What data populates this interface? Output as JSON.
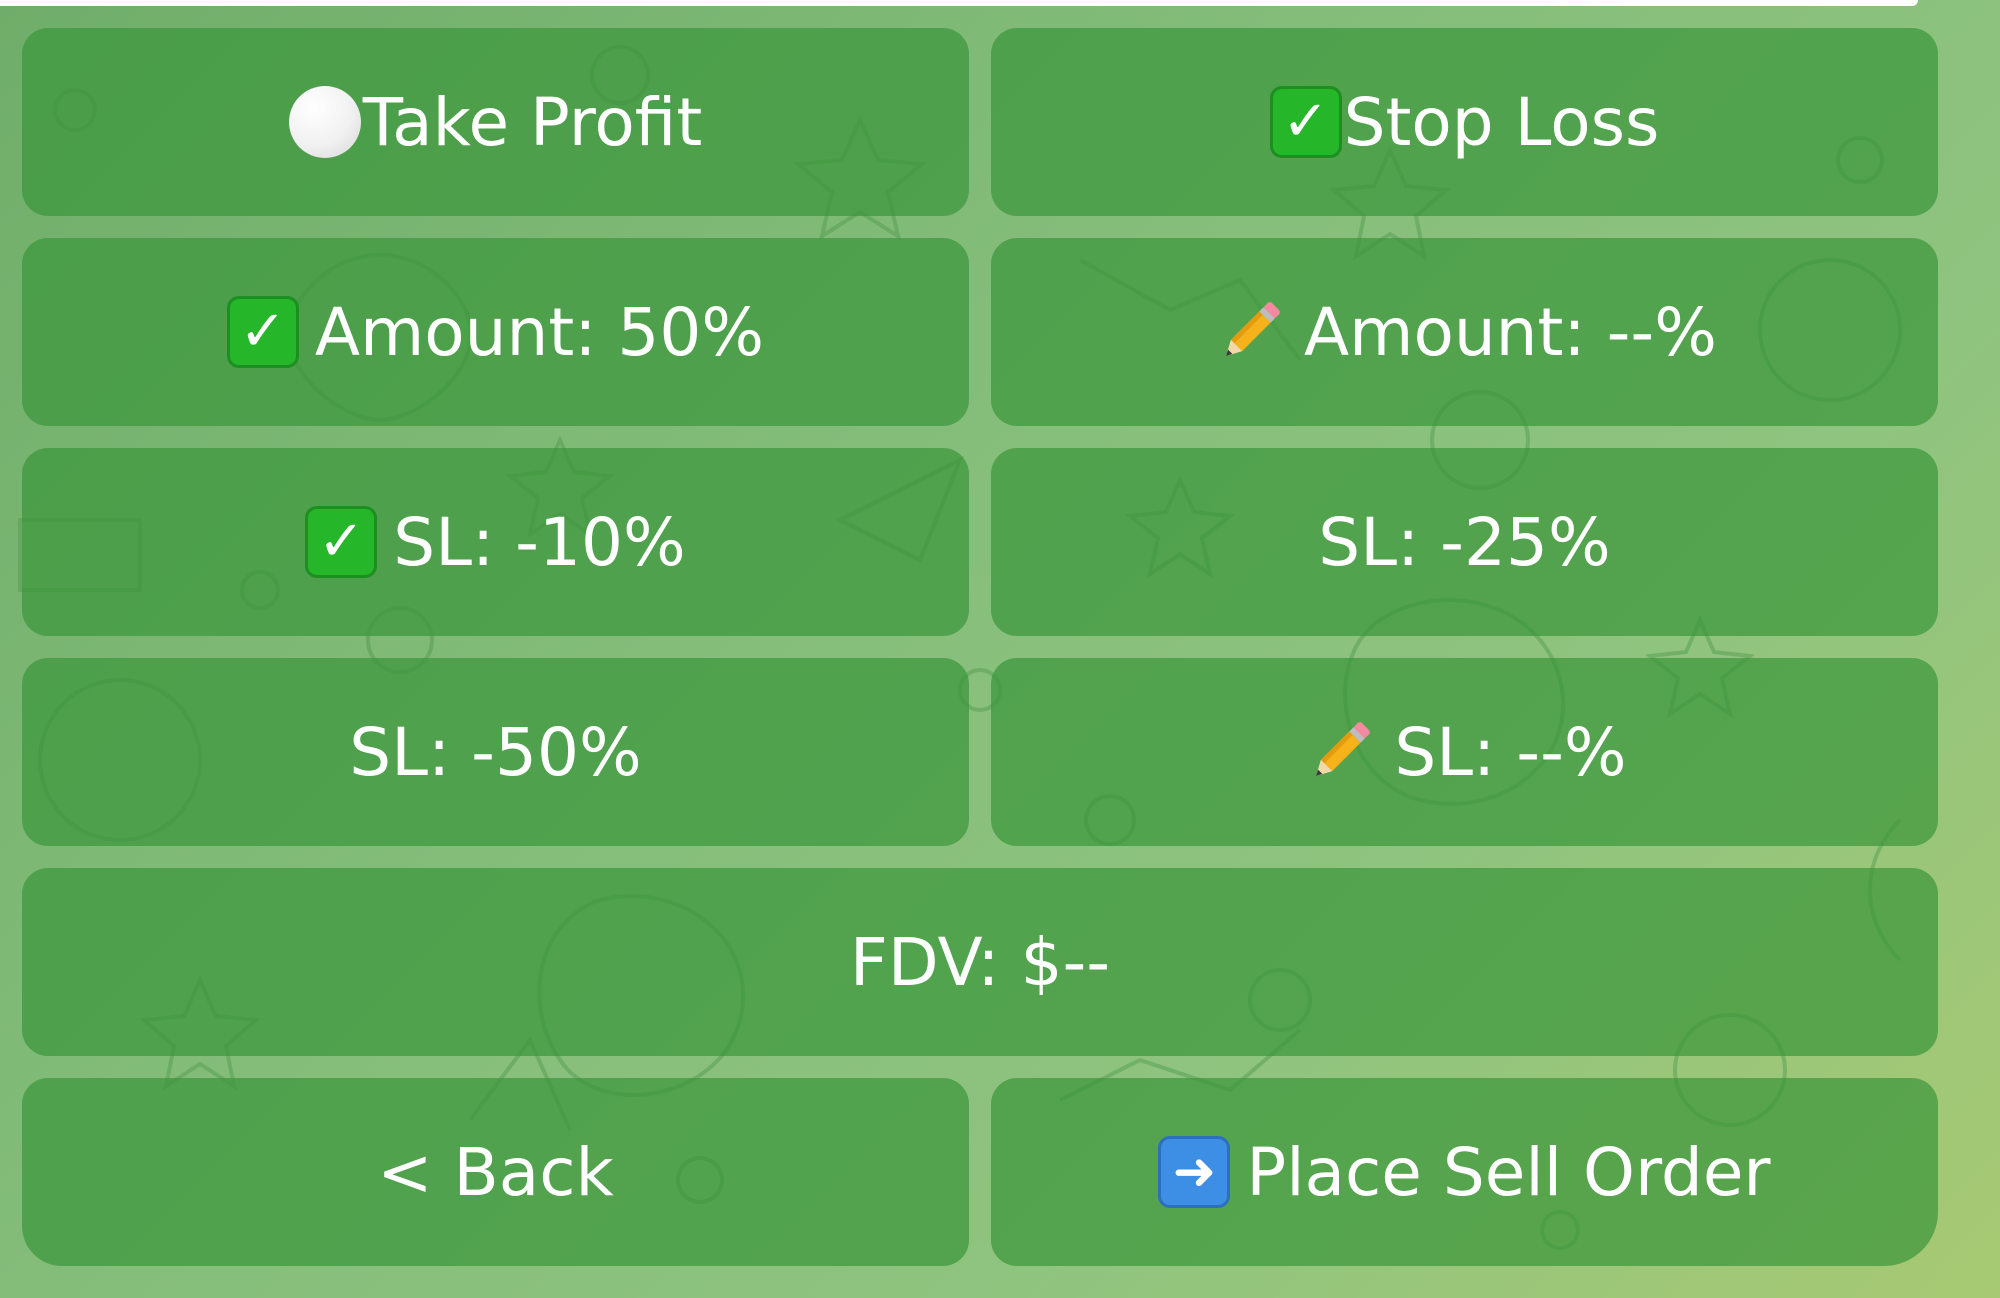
{
  "icons": {
    "take_profit": "white-circle-icon",
    "stop_loss": "check-box-icon",
    "tp_amount": "check-box-icon",
    "sl_amount": "pencil-icon",
    "sl_10": "check-box-icon",
    "sl_custom": "pencil-icon",
    "place_order": "right-arrow-icon"
  },
  "glyphs": {
    "check": "✓",
    "arrow": "➜"
  },
  "colors": {
    "button_bg": "#3a963a",
    "button_text": "#ffffff",
    "check_green": "#25b62a",
    "arrow_blue": "#3d8fe6",
    "background": "#84bd7a"
  },
  "keyboard": {
    "row1": {
      "left": "Take Profit",
      "right": "Stop Loss"
    },
    "row2": {
      "left": "Amount: 50%",
      "right": "Amount: --%"
    },
    "row3": {
      "left": "SL: -10%",
      "right": "SL: -25%"
    },
    "row4": {
      "left": "SL: -50%",
      "right": "SL: --%"
    },
    "row5": {
      "full": "FDV: $--"
    },
    "row6": {
      "left": "< Back",
      "right": "Place Sell Order"
    }
  }
}
